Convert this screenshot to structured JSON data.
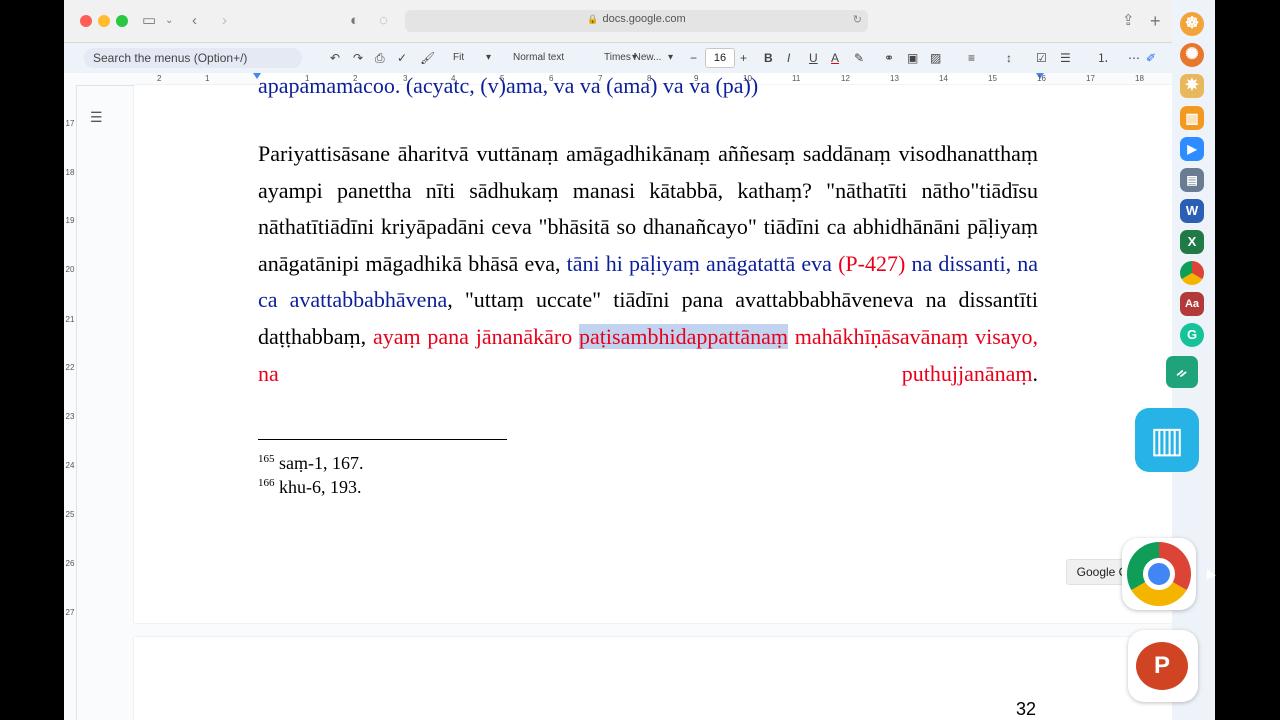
{
  "browser": {
    "url": "docs.google.com"
  },
  "toolbar": {
    "search_menus": "Search the menus (Option+/)",
    "zoom": "Fit",
    "style": "Normal text",
    "font": "Times New...",
    "font_size": "16",
    "minus": "−",
    "plus": "+",
    "bold": "B",
    "italic": "I",
    "underline": "U",
    "text_color": "A"
  },
  "ruler": {
    "h_numbers": [
      "2",
      "1",
      "1",
      "2",
      "3",
      "4",
      "5",
      "6",
      "7",
      "8",
      "9",
      "10",
      "11",
      "12",
      "13",
      "14",
      "15",
      "16",
      "17",
      "18"
    ],
    "v_numbers": [
      "17",
      "18",
      "19",
      "20",
      "21",
      "22",
      "23",
      "24",
      "25",
      "26",
      "27"
    ]
  },
  "document": {
    "cut_line": "apapamamacoo. (acyatc, (v)ama, va va (ama) va va (pa))",
    "para": {
      "s1": "Pariyattisāsane āharitvā vuttānaṃ amāgadhikānaṃ aññesaṃ saddānaṃ visodhanatthaṃ ayampi panettha nīti sādhukaṃ manasi kātabbā, kathaṃ? \"nāthatīti nātho\"tiādīsu nāthatītiādīni kriyāpadāni ceva \"bhāsitā so dhanañcayo\" tiādīni ca abhidhānāni pāḷiyaṃ anāgatānipi māgadhikā bhāsā eva,",
      "blue1": "tāni hi pāḷiyaṃ anāgatattā eva",
      "red1": "(P-427)",
      "blue2": "na dissanti, na ca avattabbabhāvena",
      "s2": ", \"uttaṃ uccate\" tiādīni pana avattabbabhāveneva na dissantīti daṭṭhabbaṃ,",
      "red2": "ayaṃ pana jānanākāro",
      "red_hl": "paṭisambhidappattānaṃ",
      "red3": "mahākhīṇāsavānaṃ visayo, na puthujjanānaṃ",
      "end": "."
    },
    "footnotes": [
      {
        "num": "165",
        "text": "saṃ-1, 167."
      },
      {
        "num": "166",
        "text": "khu-6, 193."
      }
    ],
    "page_number": "32"
  },
  "tooltip": "Google Chrome",
  "colors": {
    "blue_text": "#0b1f9b",
    "red_text": "#e8001a",
    "highlight": "#c2d3ef"
  }
}
